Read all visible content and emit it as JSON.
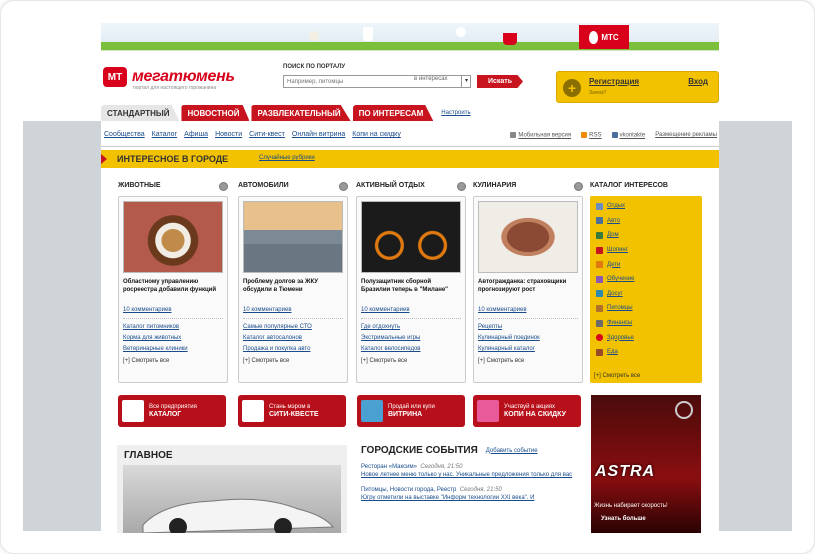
{
  "banner": {
    "operator": "МТС"
  },
  "logo": {
    "mark": "МТ",
    "name": "мегатюмень",
    "tagline": "портал для настоящего горожанина"
  },
  "search": {
    "label": "ПОИСК ПО ПОРТАЛУ",
    "placeholder": "Например, питомцы",
    "scope": "в интересах",
    "button": "Искать"
  },
  "auth": {
    "register": "Регистрация",
    "why": "Зачем?",
    "login": "Вход"
  },
  "tabs": [
    {
      "label": "СТАНДАРТНЫЙ"
    },
    {
      "label": "НОВОСТНОЙ"
    },
    {
      "label": "РАЗВЛЕКАТЕЛЬНЫЙ"
    },
    {
      "label": "ПО ИНТЕРЕСАМ"
    }
  ],
  "customize": "Настроить",
  "nav": {
    "links": [
      "Сообщества",
      "Каталог",
      "Афиша",
      "Новости",
      "Сити-квест",
      "Онлайн витрина",
      "Копи на скидку"
    ],
    "mobile": "Мобильная версия",
    "rss": "RSS",
    "vk": "vkontakte",
    "ads": "Размещение рекламы"
  },
  "interesting": {
    "title": "ИНТЕРЕСНОЕ В ГОРОДЕ",
    "random": "Случайные рубрики"
  },
  "columns": [
    {
      "title": "ЖИВОТНЫЕ",
      "caption": "Областному управлению росреестра добавили функций",
      "comments": "10 комментариев",
      "links": [
        "Каталог питомников",
        "Корма для животных",
        "Ветеринарные клиники"
      ],
      "all": "[+]  Смотреть все"
    },
    {
      "title": "АВТОМОБИЛИ",
      "caption": "Проблему долгов за ЖКУ обсудили в Тюмени",
      "comments": "10 комментариев",
      "links": [
        "Самые популярные СТО",
        "Каталог автосалонов",
        "Продажа и покупка авто"
      ],
      "all": "[+]  Смотреть все"
    },
    {
      "title": "АКТИВНЫЙ ОТДЫХ",
      "caption": "Полузащитник сборной Бразилии теперь в \"Милане\"",
      "comments": "10 комментариев",
      "links": [
        "Где отдохнуть",
        "Экстримальные игры",
        "Каталог велосипедов"
      ],
      "all": "[+]  Смотреть все"
    },
    {
      "title": "КУЛИНАРИЯ",
      "caption": "Автогражданка: страховщики прогнозируют рост",
      "comments": "10 комментариев",
      "links": [
        "Рецепты",
        "Кулинарный поединок",
        "Кулинарный каталог"
      ],
      "all": "[+]  Смотреть все"
    }
  ],
  "catalog": {
    "title": "КАТАЛОГ ИНТЕРЕСОВ",
    "items": [
      "Отдых",
      "Авто",
      "Дом",
      "Шопинг",
      "Дети",
      "Обучение",
      "Досуг",
      "Питомцы",
      "Финансы",
      "Здоровье",
      "Еда"
    ],
    "all": "[+]  Смотреть все"
  },
  "promos": [
    {
      "line1": "Все предприятия",
      "line2": "КАТАЛОГ"
    },
    {
      "line1": "Стань мэром в",
      "line2": "СИТИ-КВЕСТЕ"
    },
    {
      "line1": "Продай или купи",
      "line2": "ВИТРИНА"
    },
    {
      "line1": "Участвуй в акциях",
      "line2": "КОПИ НА СКИДКУ"
    }
  ],
  "main": {
    "title": "ГЛАВНОЕ"
  },
  "events": {
    "title": "ГОРОДСКИЕ СОБЫТИЯ",
    "add": "Добавить событие",
    "items": [
      {
        "place": "Ресторан «Максим»",
        "time": "Сегодня, 21:50",
        "text": "Новое летнее меню только у нас. Уникальные предложения только для вас"
      },
      {
        "place": "Питомцы, Новости города, Реестр",
        "time": "Сегодня, 21:50",
        "text": "Югру отметили на выставке \"Информ технологии XXI века\". И"
      }
    ]
  },
  "ad": {
    "brand": "ASTRA",
    "slogan": "Жизнь набирает скорость!",
    "more": "Узнать больше"
  },
  "colors": {
    "brand_red": "#c8141e",
    "accent_yellow": "#f2c200",
    "link_blue": "#1a4c8c"
  }
}
